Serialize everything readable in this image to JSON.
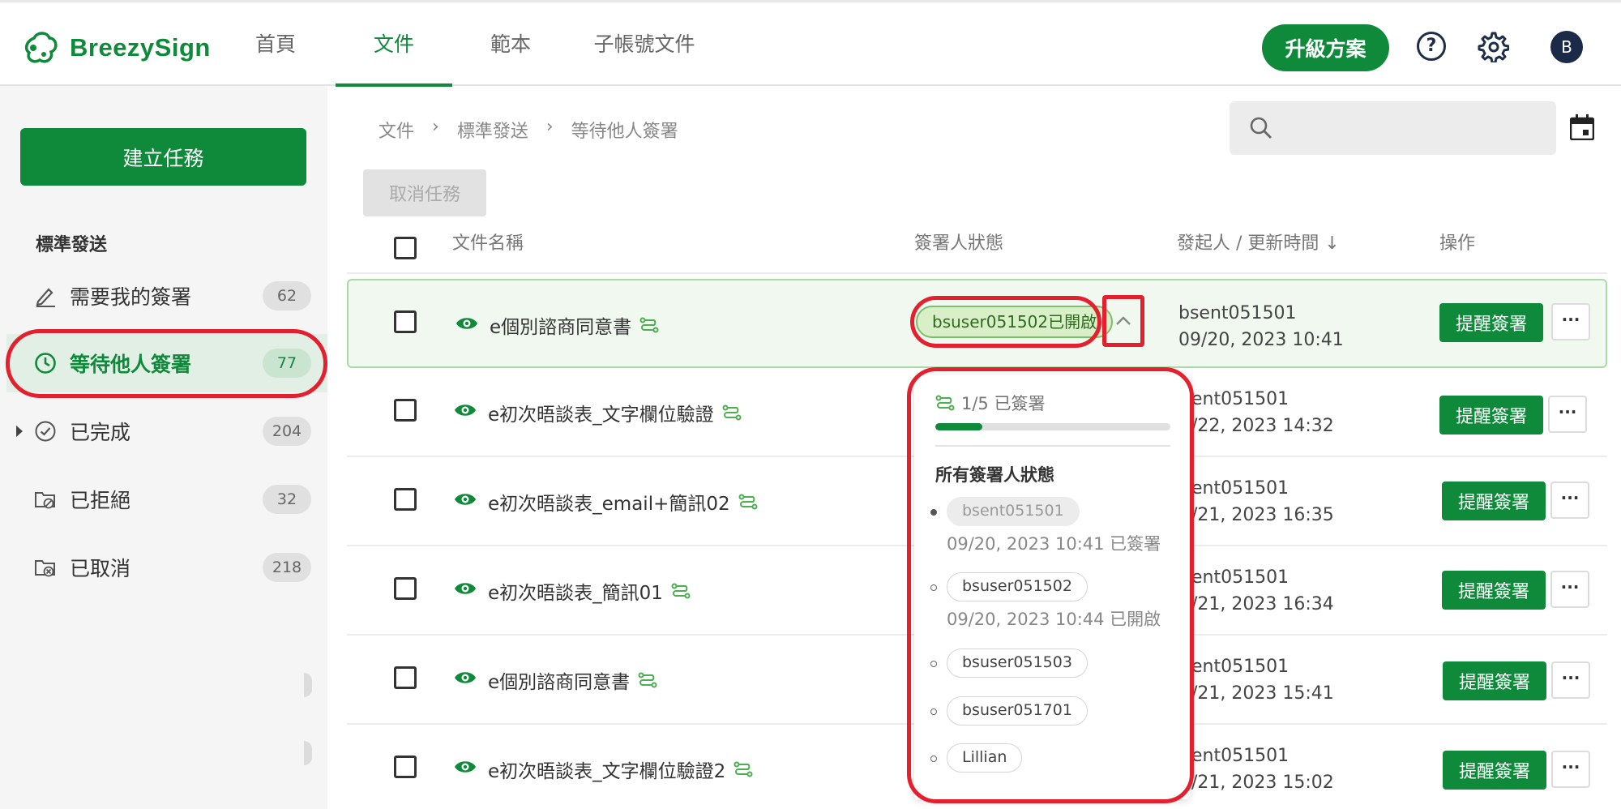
{
  "app": {
    "name": "BreezySign"
  },
  "nav": {
    "tabs": [
      {
        "label": "首頁"
      },
      {
        "label": "文件"
      },
      {
        "label": "範本"
      },
      {
        "label": "子帳號文件"
      }
    ],
    "upgrade_label": "升級方案",
    "help_glyph": "?",
    "avatar_letter": "B"
  },
  "sidebar": {
    "create_label": "建立任務",
    "section_heading": "標準發送",
    "items": [
      {
        "label": "需要我的簽署",
        "count": "62",
        "icon": "pen-icon"
      },
      {
        "label": "等待他人簽署",
        "count": "77",
        "icon": "clock-icon"
      },
      {
        "label": "已完成",
        "count": "204",
        "icon": "check-circle-icon"
      },
      {
        "label": "已拒絕",
        "count": "32",
        "icon": "folder-reject-icon"
      },
      {
        "label": "已取消",
        "count": "218",
        "icon": "folder-cancel-icon"
      }
    ]
  },
  "breadcrumb": {
    "items": [
      "文件",
      "標準發送",
      "等待他人簽署"
    ],
    "separator": "›"
  },
  "toolbar": {
    "cancel_task_label": "取消任務"
  },
  "table": {
    "headers": {
      "name": "文件名稱",
      "status": "簽署人狀態",
      "sender": "發起人 / 更新時間",
      "sort_arrow": "↓",
      "actions": "操作"
    },
    "rows": [
      {
        "name": "e個別諮商同意書",
        "sender": "bsent051501",
        "time": "09/20, 2023 10:41",
        "status": "bsuser051502已開啟"
      },
      {
        "name": "e初次晤談表_文字欄位驗證",
        "sender": "ent051501",
        "time": "/22, 2023 14:32"
      },
      {
        "name": "e初次晤談表_email+簡訊02",
        "sender": "ent051501",
        "time": "/21, 2023 16:35"
      },
      {
        "name": "e初次晤談表_簡訊01",
        "sender": "ent051501",
        "time": "/21, 2023 16:34"
      },
      {
        "name": "e個別諮商同意書",
        "sender": "ent051501",
        "time": "/21, 2023 15:41"
      },
      {
        "name": "e初次晤談表_文字欄位驗證2",
        "sender": "ent051501",
        "time": "/21, 2023 15:02"
      }
    ],
    "remind_label": "提醒簽署",
    "more_label": "···"
  },
  "popover": {
    "progress_text": "1/5 已簽署",
    "progress_fraction": 0.2,
    "heading": "所有簽署人狀態",
    "signers": [
      {
        "name": "bsent051501",
        "meta": "09/20, 2023 10:41 已簽署",
        "state": "signed"
      },
      {
        "name": "bsuser051502",
        "meta": "09/20, 2023 10:44 已開啟",
        "state": "opened"
      },
      {
        "name": "bsuser051503",
        "meta": "",
        "state": "pending"
      },
      {
        "name": "bsuser051701",
        "meta": "",
        "state": "pending"
      },
      {
        "name": "Lillian",
        "meta": "",
        "state": "pending"
      }
    ]
  },
  "colors": {
    "brand": "#0e8a3a",
    "highlight": "#e4202f",
    "status_bg": "#d9efc8",
    "sidebar_active_bg": "#e2efe5"
  }
}
